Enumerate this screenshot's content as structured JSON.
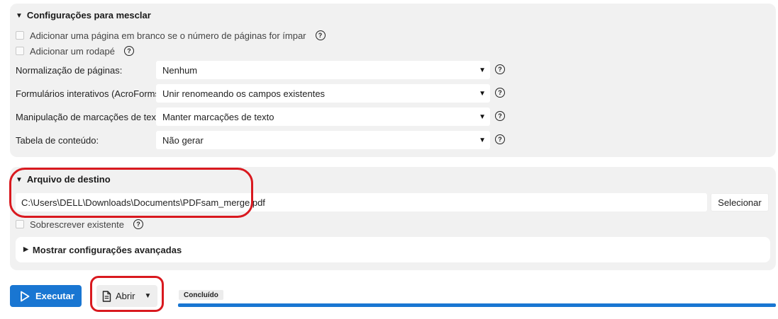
{
  "merge_settings": {
    "title": "Configurações para mesclar",
    "checkbox_blank_page": "Adicionar uma página em branco se o número de páginas for ímpar",
    "checkbox_footer": "Adicionar um rodapé",
    "page_normalization": {
      "label": "Normalização de páginas:",
      "value": "Nenhum"
    },
    "acroforms": {
      "label": "Formulários interativos (AcroForms)",
      "value": "Unir renomeando os campos existentes"
    },
    "text_markup": {
      "label": "Manipulação de marcações de texto:",
      "value": "Manter marcações de texto"
    },
    "toc": {
      "label": "Tabela de conteúdo:",
      "value": "Não gerar"
    }
  },
  "destination": {
    "title": "Arquivo de destino",
    "path": "C:\\Users\\DELL\\Downloads\\Documents\\PDFsam_merge.pdf",
    "select_button": "Selecionar",
    "overwrite_label": "Sobrescrever existente",
    "advanced_label": "Mostrar configurações avançadas"
  },
  "actions": {
    "run_label": "Executar",
    "open_label": "Abrir"
  },
  "status": {
    "label": "Concluído",
    "progress": 1.0
  },
  "icons": {
    "help": "help-circle-icon",
    "run": "play-outline-icon",
    "open": "document-icon",
    "expanded": "triangle-down-icon",
    "collapsed": "triangle-right-icon"
  },
  "colors": {
    "accent": "#1976d2",
    "annotation": "#d9191f",
    "panel_bg": "#f1f1f1"
  }
}
